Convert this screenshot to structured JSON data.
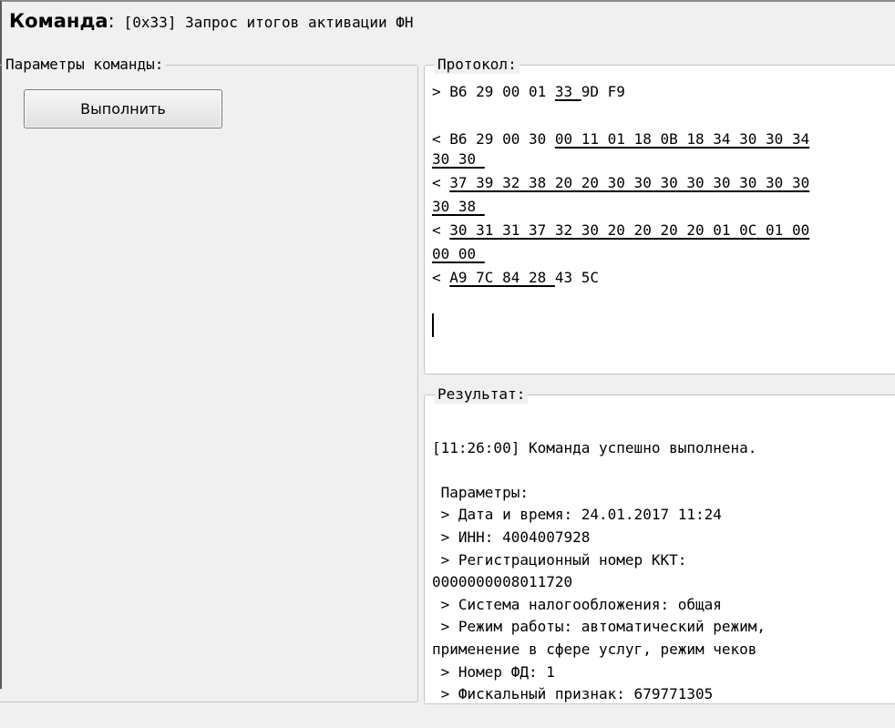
{
  "header": {
    "label": "Команда",
    "colon": ":",
    "command": "[0x33] Запрос итогов активации ФН"
  },
  "params": {
    "title": "Параметры команды:",
    "execute_button": "Выполнить"
  },
  "protocol": {
    "title": "Протокол:",
    "line1": {
      "prefix": "> B6 29 00 01 ",
      "u": "33 ",
      "suffix": "9D F9"
    },
    "line2": {
      "prefix": "< B6 29 00 30 ",
      "u": "00 11 01 18 0B 18 34 30 30 34"
    },
    "line2b": {
      "u": "30 30 "
    },
    "line3": {
      "prefix": "< ",
      "u": "37 39 32 38 20 20 30 30 30 30 30 30 30 30"
    },
    "line3b": {
      "u": "30 38 "
    },
    "line4": {
      "prefix": "< ",
      "u": "30 31 31 37 32 30 20 20 20 20 01 0C 01 00"
    },
    "line4b": {
      "u": "00 00 "
    },
    "line5": {
      "prefix": "< ",
      "u": "A9 7C 84 28 ",
      "suffix": "43 5C"
    }
  },
  "result": {
    "title": "Результат:",
    "lines": [
      "[11:26:00] Команда успешно выполнена.",
      "",
      " Параметры:",
      " > Дата и время: 24.01.2017 11:24",
      " > ИНН: 4004007928",
      " > Регистрационный номер ККТ:",
      "0000000008011720",
      " > Система налогообложения: общая",
      " > Режим работы: автоматический режим,",
      "применение в сфере услуг, режим чеков",
      " > Номер ФД: 1",
      " > Фискальный признак: 679771305"
    ]
  }
}
